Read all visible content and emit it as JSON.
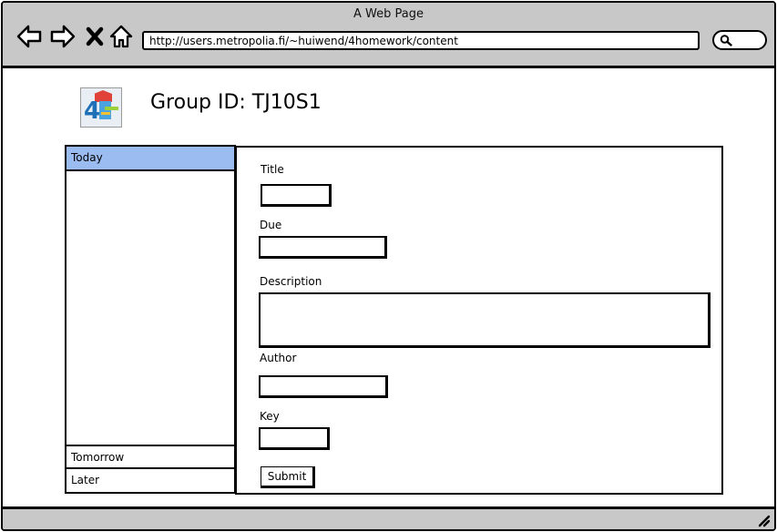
{
  "window": {
    "title": "A Web Page"
  },
  "nav": {
    "back_icon": "back-arrow-icon",
    "forward_icon": "forward-arrow-icon",
    "close_icon": "close-icon",
    "home_icon": "home-icon"
  },
  "address_bar": {
    "url": "http://users.metropolia.fi/~huiwend/4homework/content"
  },
  "search": {
    "icon": "search-icon"
  },
  "header": {
    "logo_text": "4",
    "group_label": "Group ID: TJ10S1"
  },
  "sidebar": {
    "items": [
      {
        "label": "Today",
        "active": true
      },
      {
        "label": "Tomorrow",
        "active": false
      },
      {
        "label": "Later",
        "active": false
      }
    ]
  },
  "form": {
    "title_label": "Title",
    "due_label": "Due",
    "description_label": "Description",
    "author_label": "Author",
    "key_label": "Key",
    "title_value": "",
    "due_value": "",
    "description_value": "",
    "author_value": "",
    "key_value": "",
    "submit_label": "Submit"
  },
  "colors": {
    "chrome": "#c8c8c8",
    "active_item": "#9bbcf0"
  }
}
